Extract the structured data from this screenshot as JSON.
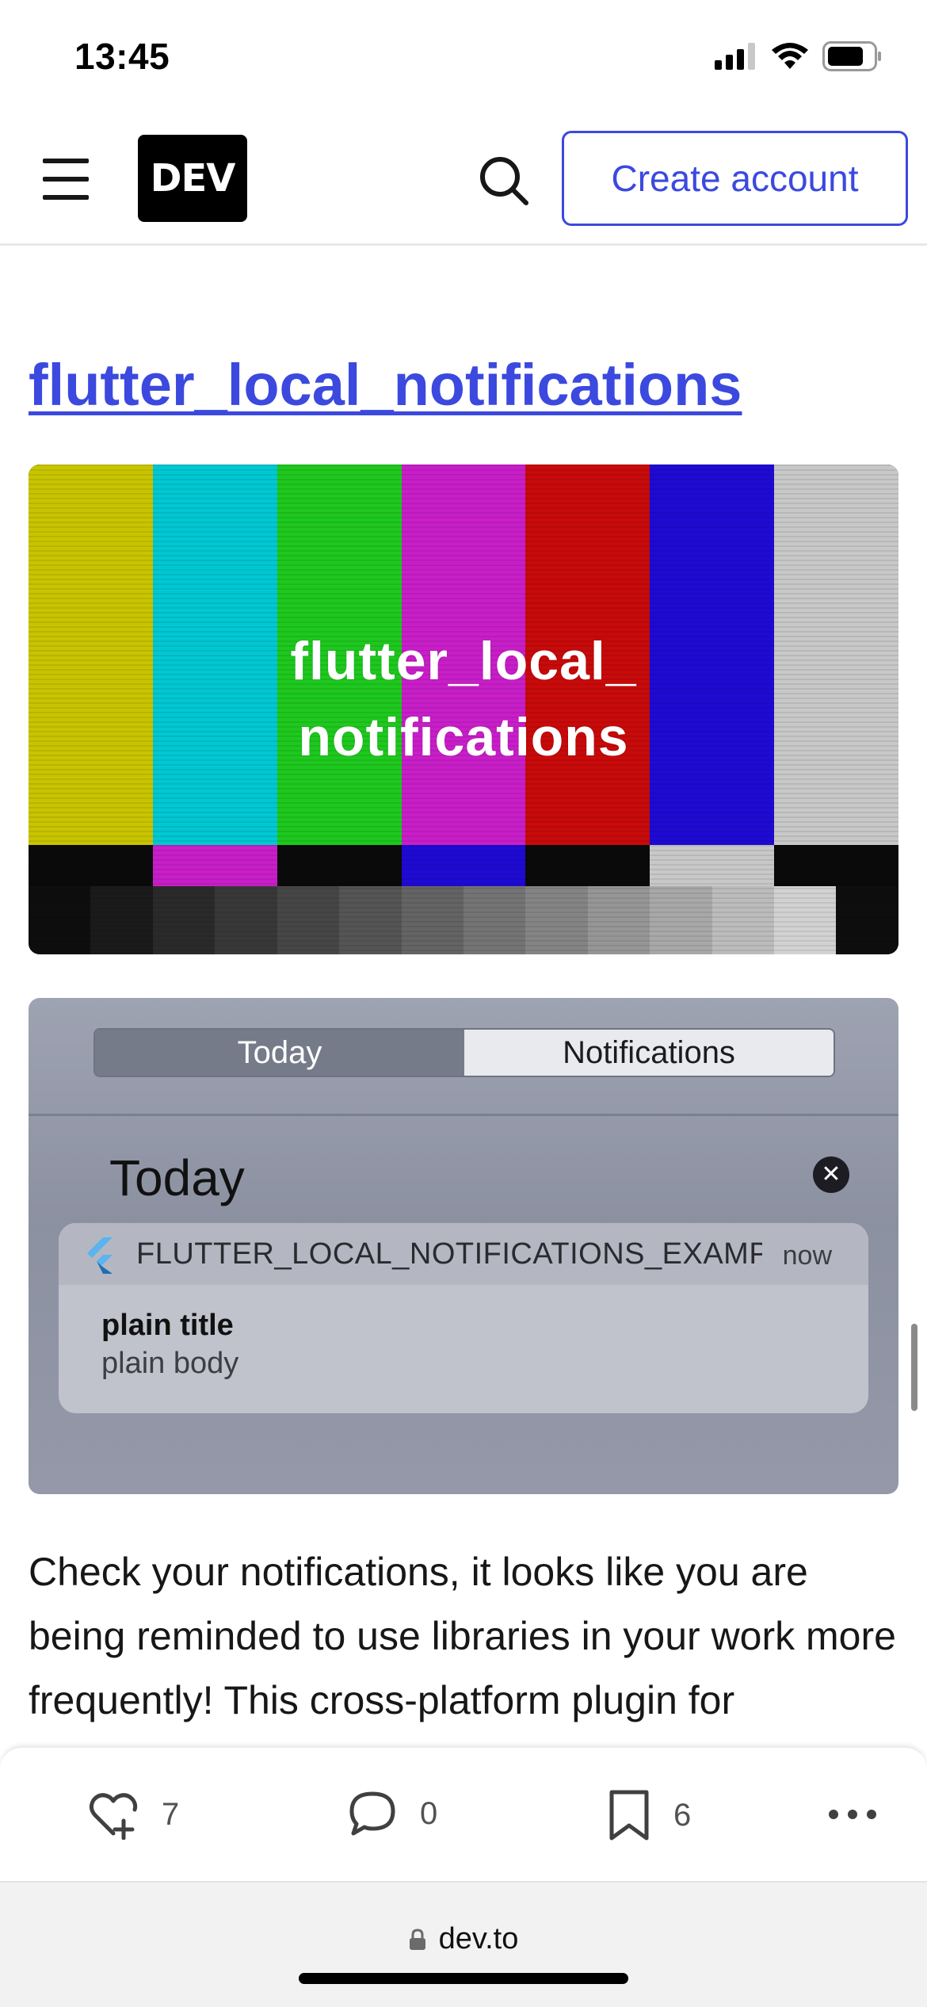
{
  "status_bar": {
    "time": "13:45",
    "icons": [
      "cellular-signal-icon",
      "wifi-icon",
      "battery-icon"
    ]
  },
  "header": {
    "logo_text": "DEV",
    "create_account_label": "Create account",
    "accent_color": "#3b49df"
  },
  "article": {
    "heading": "flutter_local_notifications",
    "bars_image": {
      "caption_line1": "flutter_local_",
      "caption_line2": "notifications",
      "top_bar_colors": [
        "#c8c400",
        "#00c8d2",
        "#1ec81e",
        "#c81ec8",
        "#c80a0a",
        "#1e0ad2",
        "#c8c8c8"
      ]
    },
    "notification_image": {
      "segment_today": "Today",
      "segment_notifications": "Notifications",
      "section_heading": "Today",
      "app_name": "FLUTTER_LOCAL_NOTIFICATIONS_EXAMPLE",
      "time": "now",
      "title": "plain title",
      "body": "plain body"
    },
    "paragraph": "Check your notifications, it looks like you are being reminded to use libraries in your work more frequently! This cross-platform plugin for displaying local notifications"
  },
  "actions": {
    "reactions_count": "7",
    "comments_count": "0",
    "saves_count": "6"
  },
  "browser": {
    "url": "dev.to"
  }
}
